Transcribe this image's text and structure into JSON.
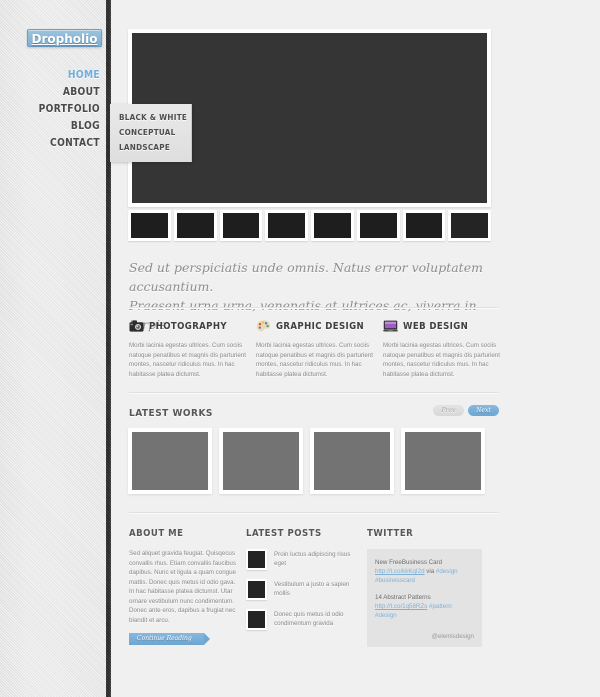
{
  "site": {
    "logo": "Dropholio"
  },
  "nav": {
    "items": [
      {
        "label": "HOME",
        "active": true
      },
      {
        "label": "ABOUT",
        "active": false
      },
      {
        "label": "PORTFOLIO",
        "active": false
      },
      {
        "label": "BLOG",
        "active": false
      },
      {
        "label": "CONTACT",
        "active": false
      }
    ]
  },
  "submenu": {
    "items": [
      {
        "label": "BLACK & WHITE"
      },
      {
        "label": "CONCEPTUAL"
      },
      {
        "label": "LANDSCAPE"
      }
    ]
  },
  "hero": {
    "thumb_count": 8,
    "active_index": 7
  },
  "tagline": {
    "line1": "Sed ut perspiciatis unde omnis. Natus error voluptatem accusantium.",
    "line2": "Praesent urna urna, venenatis at ultrices ac, viverra in turpis."
  },
  "services": [
    {
      "icon": "camera-icon",
      "title": "PHOTOGRAPHY",
      "body": "Morbi lacinia egestas ultrices. Cum sociis natoque penatibus et magnis dis parturient montes, nascetur ridiculus mus. In hac habitasse platea dictumst."
    },
    {
      "icon": "palette-icon",
      "title": "GRAPHIC DESIGN",
      "body": "Morbi lacinia egestas ultrices. Cum sociis natoque penatibus et magnis dis parturient montes, nascetur ridiculus mus. In hac habitasse platea dictumst."
    },
    {
      "icon": "monitor-icon",
      "title": "WEB DESIGN",
      "body": "Morbi lacinia egestas ultrices. Cum sociis natoque penatibus et magnis dis parturient montes, nascetur ridiculus mus. In hac habitasse platea dictumst."
    }
  ],
  "works": {
    "heading": "LATEST WORKS",
    "prev_label": "Prev",
    "next_label": "Next",
    "item_count": 4
  },
  "about": {
    "heading": "ABOUT ME",
    "body": "Sed aliquet gravida feugiat. Quisqecus convallis rhus. Etiam convallis faucibus dapibus. Nunc et ligula a quam congue mattis. Donec quis metus id odio gava. In hac habitasse platea dictumst. Utar ornare vestibulum nunc condimentum. Donec ante eros, dapibus a frugiat nec blandit et arcu.",
    "button_label": "Continue Reading"
  },
  "posts": {
    "heading": "LATEST POSTS",
    "items": [
      {
        "text": "Proin luctus adipiscing risus eget"
      },
      {
        "text": "Vestibulum a justo a sapien mollis"
      },
      {
        "text": "Donec quis metus id odio condimentum gravida"
      }
    ]
  },
  "twitter": {
    "heading": "TWITTER",
    "tweets": [
      {
        "title": "New FreeBusiness Card",
        "link": "http://t.co/kkKqI2d",
        "via": "via",
        "tags": "#design #businesscard"
      },
      {
        "title": "14 Abstract Patterns",
        "link": "http://t.co/1q58RZs",
        "via": "",
        "tags": "#pattern #design"
      }
    ],
    "handle": "@elemisdesign"
  },
  "colors": {
    "accent": "#7fb0d2",
    "dark": "#353535",
    "background": "#f0f0f0",
    "muted": "#8a8a8a"
  }
}
